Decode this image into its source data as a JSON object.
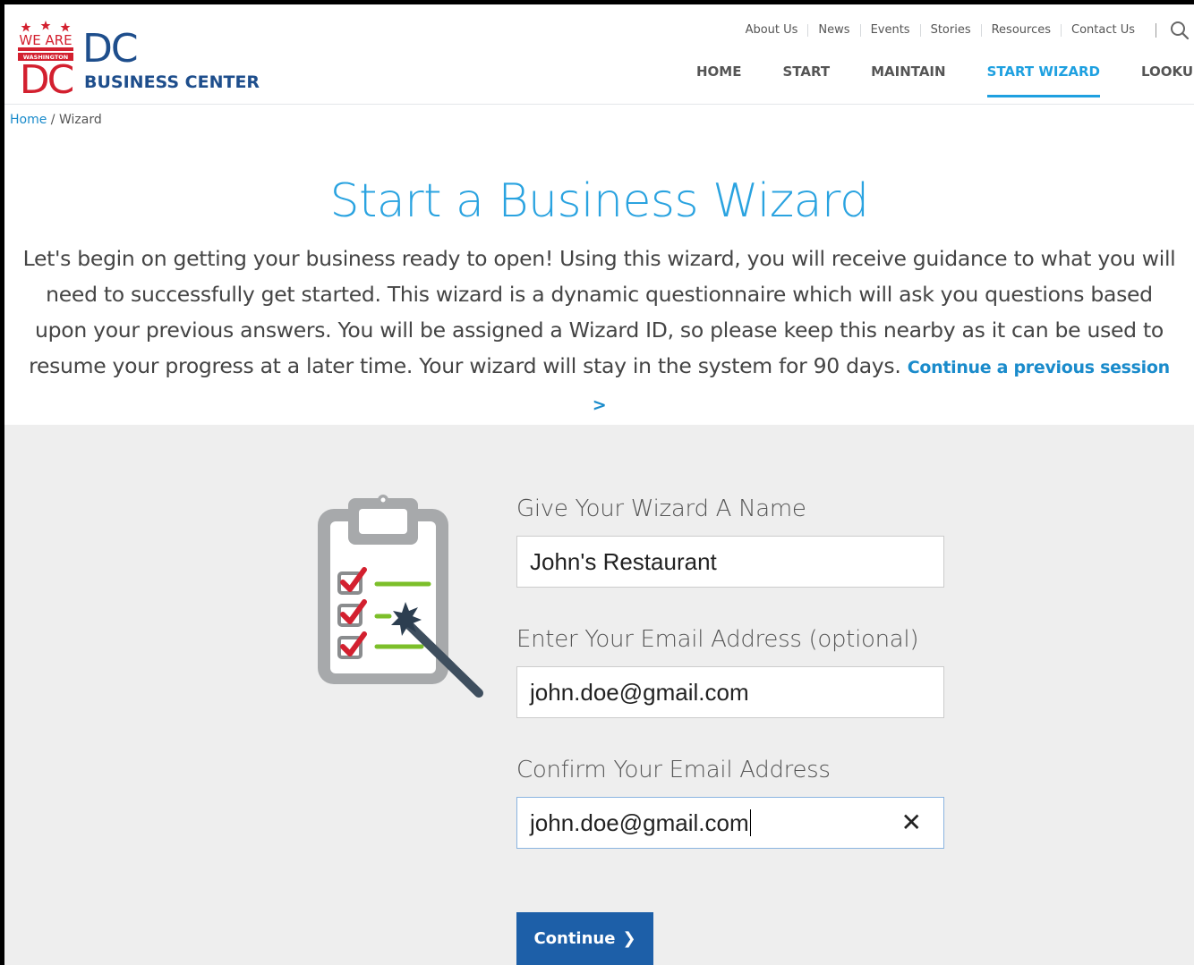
{
  "logo": {
    "badge_top": "WE ARE",
    "badge_mid": "WASHINGTON",
    "badge_bottom": "DC",
    "name": "DC",
    "subtitle": "BUSINESS CENTER",
    "colors": {
      "red": "#d3202f",
      "blue": "#1e4e8c"
    }
  },
  "util_nav": [
    "About Us",
    "News",
    "Events",
    "Stories",
    "Resources",
    "Contact Us"
  ],
  "main_nav": [
    {
      "label": "HOME",
      "active": false
    },
    {
      "label": "START",
      "active": false
    },
    {
      "label": "MAINTAIN",
      "active": false
    },
    {
      "label": "START WIZARD",
      "active": true
    },
    {
      "label": "LOOKUP",
      "active": false
    }
  ],
  "breadcrumb": {
    "home": "Home",
    "sep": " / ",
    "current": "Wizard"
  },
  "hero": {
    "title": "Start a Business Wizard",
    "text": "Let's begin on getting your business ready to open! Using this wizard, you will receive guidance to what you will need to successfully get started. This wizard is a dynamic questionnaire which will ask you questions based upon your previous answers. You will be assigned a Wizard ID, so please keep this nearby as it can be used to resume your progress at a later time. Your wizard will stay in the system for 90 days.",
    "link": "Continue a previous session >"
  },
  "form": {
    "name_label": "Give Your Wizard A Name",
    "name_value": "John's Restaurant",
    "email_label": "Enter Your Email Address (optional)",
    "email_value": "john.doe@gmail.com",
    "confirm_label": "Confirm Your Email Address",
    "confirm_value": "john.doe@gmail.com",
    "clear_symbol": "✕",
    "continue_label": "Continue",
    "continue_icon": "❯"
  },
  "colors": {
    "accent": "#2aa3e0",
    "link": "#1a8bcb",
    "button": "#1d5fa8",
    "band": "#eeeeee"
  }
}
